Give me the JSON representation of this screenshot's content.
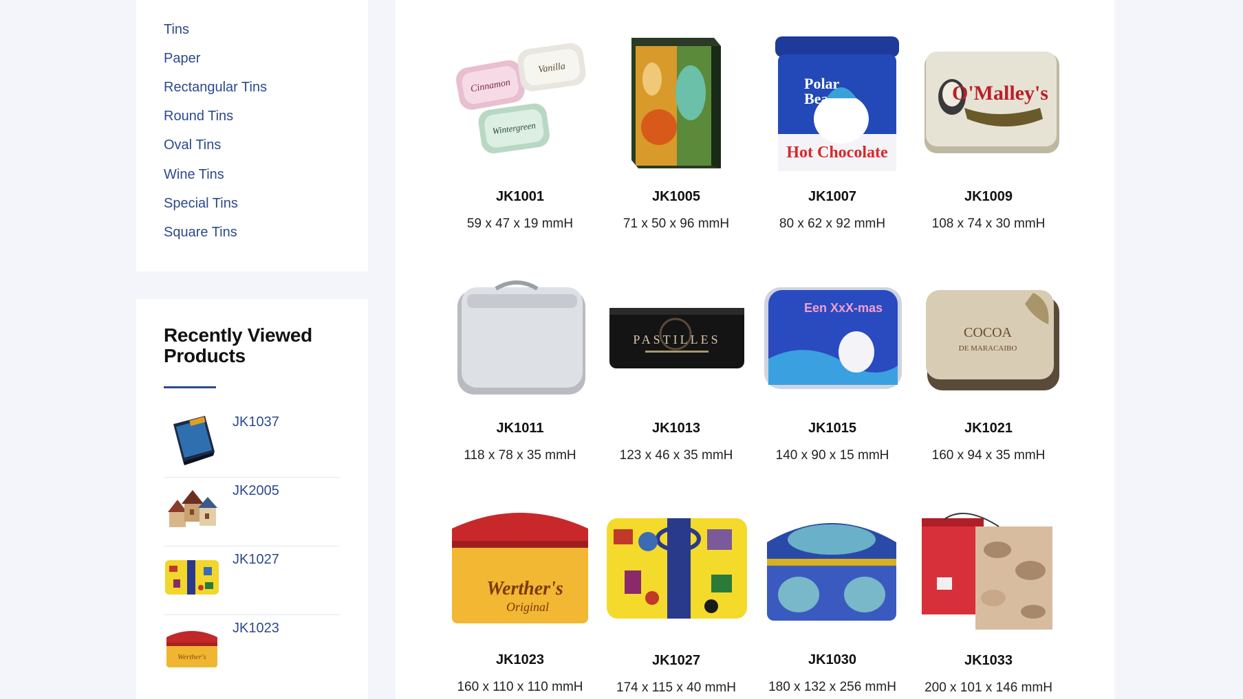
{
  "categories": [
    "Tins",
    "Paper",
    "Rectangular Tins",
    "Round Tins",
    "Oval Tins",
    "Wine Tins",
    "Special Tins",
    "Square Tins"
  ],
  "recent": {
    "title": "Recently Viewed Products",
    "items": [
      {
        "code": "JK1037",
        "image": "blue-book-tin-thumb"
      },
      {
        "code": "JK2005",
        "image": "house-shaped-tins-thumb"
      },
      {
        "code": "JK1027",
        "image": "yellow-suitcase-tin-thumb"
      },
      {
        "code": "JK1023",
        "image": "werthers-tin-thumb"
      }
    ]
  },
  "products": [
    {
      "code": "JK1001",
      "size": "59 x 47 x 19 mmH",
      "image": "mint-tins-image"
    },
    {
      "code": "JK1005",
      "size": "71 x 50 x 96 mmH",
      "image": "fairy-tin-image"
    },
    {
      "code": "JK1007",
      "size": "80 x 62 x 92 mmH",
      "image": "polar-bear-hot-chocolate-tin-image"
    },
    {
      "code": "JK1009",
      "size": "108 x 74 x 30 mmH",
      "image": "omalleys-tin-image"
    },
    {
      "code": "JK1011",
      "size": "118 x 78 x 35 mmH",
      "image": "silver-lunchbox-tin-image"
    },
    {
      "code": "JK1013",
      "size": "123 x 46 x 35 mmH",
      "image": "pastilles-tin-image"
    },
    {
      "code": "JK1015",
      "size": "140 x 90 x 15 mmH",
      "image": "xmas-polar-bear-tin-image"
    },
    {
      "code": "JK1021",
      "size": "160 x 94 x 35 mmH",
      "image": "cocoa-tin-image"
    },
    {
      "code": "JK1023",
      "size": "160 x 110 x 110 mmH",
      "image": "werthers-tin-image"
    },
    {
      "code": "JK1027",
      "size": "174 x 115 x 40 mmH",
      "image": "yellow-suitcase-tin-image"
    },
    {
      "code": "JK1030",
      "size": "180 x 132 x 256 mmH",
      "image": "blue-chest-tin-image"
    },
    {
      "code": "JK1033",
      "size": "200 x 101 x 146 mmH",
      "image": "red-camo-box-tins-image"
    }
  ]
}
